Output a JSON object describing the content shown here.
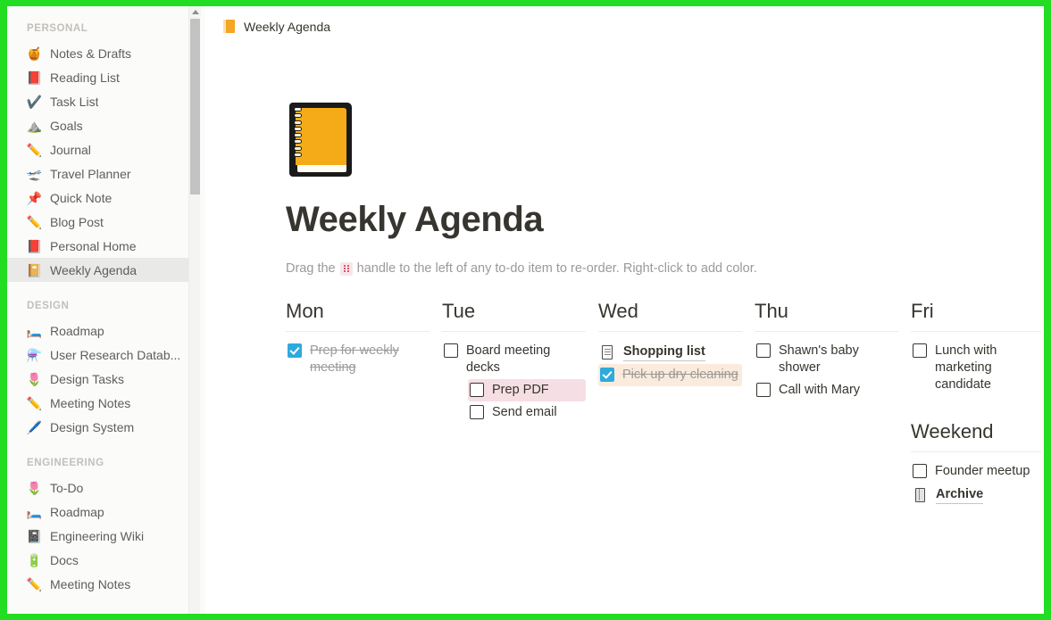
{
  "theme": {
    "frame_border": "#22dd22",
    "accent_checkbox": "#2eaadc",
    "highlight_pink": "#f6dfe4",
    "highlight_orange": "#faebdd",
    "sidebar_bg": "#fbfbfa",
    "active_item_bg": "#e9e9e7",
    "text_primary": "#37352f",
    "text_muted": "#9b9a97"
  },
  "sidebar": {
    "sections": [
      {
        "label": "PERSONAL",
        "items": [
          {
            "icon": "honey-pot-icon",
            "glyph": "🍯",
            "label": "Notes & Drafts",
            "active": false
          },
          {
            "icon": "closed-book-icon",
            "glyph": "📕",
            "label": "Reading List",
            "active": false
          },
          {
            "icon": "check-mark-icon",
            "glyph": "✔️",
            "label": "Task List",
            "active": false
          },
          {
            "icon": "mountain-icon",
            "glyph": "⛰️",
            "label": "Goals",
            "active": false
          },
          {
            "icon": "pencil-icon",
            "glyph": "✏️",
            "label": "Journal",
            "active": false
          },
          {
            "icon": "airplane-icon",
            "glyph": "🛫",
            "label": "Travel Planner",
            "active": false
          },
          {
            "icon": "pushpin-icon",
            "glyph": "📌",
            "label": "Quick Note",
            "active": false
          },
          {
            "icon": "pencil-icon",
            "glyph": "✏️",
            "label": "Blog Post",
            "active": false
          },
          {
            "icon": "closed-book-icon",
            "glyph": "📕",
            "label": "Personal Home",
            "active": false
          },
          {
            "icon": "notebook-icon",
            "glyph": "📔",
            "label": "Weekly Agenda",
            "active": true
          }
        ]
      },
      {
        "label": "DESIGN",
        "items": [
          {
            "icon": "bed-icon",
            "glyph": "🛏️",
            "label": "Roadmap",
            "active": false
          },
          {
            "icon": "alembic-icon",
            "glyph": "⚗️",
            "label": "User Research Datab...",
            "active": false
          },
          {
            "icon": "tulip-icon",
            "glyph": "🌷",
            "label": "Design Tasks",
            "active": false
          },
          {
            "icon": "pencil-icon",
            "glyph": "✏️",
            "label": "Meeting Notes",
            "active": false
          },
          {
            "icon": "pen-icon",
            "glyph": "🖊️",
            "label": "Design System",
            "active": false
          }
        ]
      },
      {
        "label": "ENGINEERING",
        "items": [
          {
            "icon": "tulip-icon",
            "glyph": "🌷",
            "label": "To-Do",
            "active": false
          },
          {
            "icon": "bed-icon",
            "glyph": "🛏️",
            "label": "Roadmap",
            "active": false
          },
          {
            "icon": "notebook-icon",
            "glyph": "📓",
            "label": "Engineering Wiki",
            "active": false
          },
          {
            "icon": "battery-icon",
            "glyph": "🔋",
            "label": "Docs",
            "active": false
          },
          {
            "icon": "pencil-icon",
            "glyph": "✏️",
            "label": "Meeting Notes",
            "active": false
          }
        ]
      }
    ]
  },
  "breadcrumb": {
    "icon": "notebook-icon",
    "label": "Weekly Agenda"
  },
  "page": {
    "icon": "orange-notebook-icon",
    "title": "Weekly Agenda",
    "hint_before": "Drag the",
    "hint_handle_icon": "drag-handle-icon",
    "hint_after": "handle to the left of any to-do item to re-order. Right-click to add color."
  },
  "columns": [
    {
      "heading": "Mon",
      "items": [
        {
          "type": "todo",
          "text": "Prep for weekly meeting",
          "checked": true,
          "indent": false,
          "highlight": "none"
        }
      ]
    },
    {
      "heading": "Tue",
      "items": [
        {
          "type": "todo",
          "text": "Board meeting decks",
          "checked": false,
          "indent": false,
          "highlight": "none"
        },
        {
          "type": "todo",
          "text": "Prep PDF",
          "checked": false,
          "indent": true,
          "highlight": "pink"
        },
        {
          "type": "todo",
          "text": "Send email",
          "checked": false,
          "indent": true,
          "highlight": "none"
        }
      ]
    },
    {
      "heading": "Wed",
      "items": [
        {
          "type": "pagelink",
          "text": "Shopping list",
          "icon": "document-icon"
        },
        {
          "type": "todo",
          "text": "Pick up dry cleaning",
          "checked": true,
          "indent": false,
          "highlight": "orange"
        }
      ]
    },
    {
      "heading": "Thu",
      "items": [
        {
          "type": "todo",
          "text": "Shawn's baby shower",
          "checked": false,
          "indent": false,
          "highlight": "none"
        },
        {
          "type": "todo",
          "text": "Call with Mary",
          "checked": false,
          "indent": false,
          "highlight": "none"
        }
      ]
    },
    {
      "heading": "Fri",
      "items": [
        {
          "type": "todo",
          "text": "Lunch with marketing candidate",
          "checked": false,
          "indent": false,
          "highlight": "none"
        }
      ],
      "sub_heading": "Weekend",
      "sub_items": [
        {
          "type": "todo",
          "text": "Founder meetup",
          "checked": false,
          "indent": false,
          "highlight": "none"
        },
        {
          "type": "pagelink",
          "text": "Archive",
          "icon": "notebook-icon"
        }
      ]
    }
  ]
}
